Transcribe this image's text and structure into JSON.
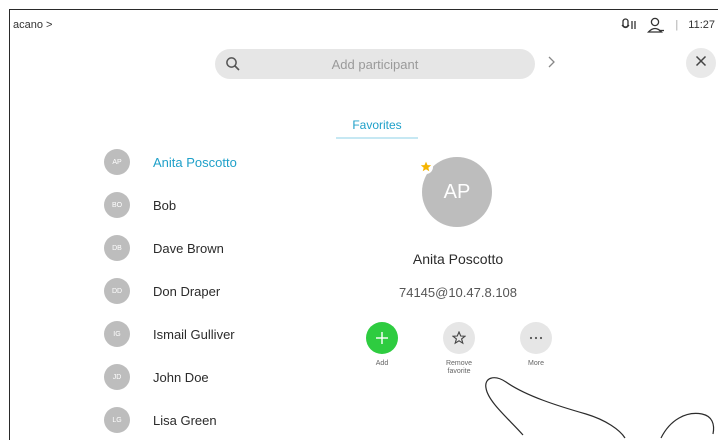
{
  "header": {
    "brand": "acano >",
    "time": "11:27",
    "separator": "|"
  },
  "search": {
    "placeholder": "Add participant"
  },
  "tabs": [
    {
      "label": "Favorites",
      "selected": true
    }
  ],
  "contacts": [
    {
      "initials": "AP",
      "name": "Anita Poscotto",
      "selected": true
    },
    {
      "initials": "BO",
      "name": "Bob"
    },
    {
      "initials": "DB",
      "name": "Dave Brown"
    },
    {
      "initials": "DD",
      "name": "Don Draper"
    },
    {
      "initials": "IG",
      "name": "Ismail Gulliver"
    },
    {
      "initials": "JD",
      "name": "John Doe"
    },
    {
      "initials": "LG",
      "name": "Lisa Green"
    }
  ],
  "detail": {
    "initials": "AP",
    "name": "Anita Poscotto",
    "address": "74145@10.47.8.108",
    "actions": [
      {
        "label": "Add",
        "icon": "plus-icon"
      },
      {
        "label": "Remove favorite",
        "icon": "star-outline-icon"
      },
      {
        "label": "More",
        "icon": "ellipsis-icon"
      }
    ]
  },
  "colors": {
    "accent": "#1fa0c9",
    "add_green": "#2ecc40",
    "favorite_star": "#f5b400"
  }
}
